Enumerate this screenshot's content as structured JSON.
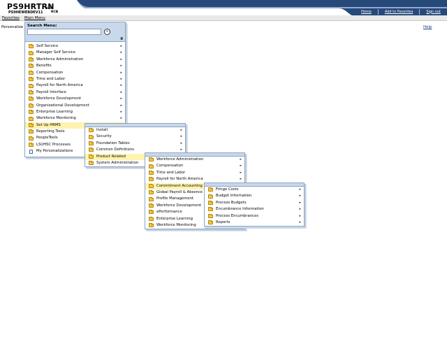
{
  "header": {
    "brand": "PS9HRTRN",
    "version": "9.00",
    "database": "PS9HEWEBDEV11",
    "user": "RCB",
    "links": [
      "Home",
      "Add to Favorites",
      "Sign out"
    ],
    "bar_color": "#27497a"
  },
  "menubar": {
    "items": [
      "Favorites",
      "Main Menu"
    ]
  },
  "page": {
    "personalize": "Personalize",
    "help": "Help"
  },
  "search_menu": {
    "title": "Search Menu:",
    "input_value": "",
    "go_label": "»",
    "scroll_top_label": "0"
  },
  "root_menu": {
    "items": [
      {
        "label": "Self Service",
        "icon": "folder-icon",
        "submenu": true
      },
      {
        "label": "Manager Self Service",
        "icon": "folder-icon",
        "submenu": true
      },
      {
        "label": "Workforce Administration",
        "icon": "folder-icon",
        "submenu": true
      },
      {
        "label": "Benefits",
        "icon": "folder-icon",
        "submenu": true
      },
      {
        "label": "Compensation",
        "icon": "folder-icon",
        "submenu": true
      },
      {
        "label": "Time and Labor",
        "icon": "folder-icon",
        "submenu": true
      },
      {
        "label": "Payroll for North America",
        "icon": "folder-icon",
        "submenu": true
      },
      {
        "label": "Payroll Interface",
        "icon": "folder-icon",
        "submenu": true
      },
      {
        "label": "Workforce Development",
        "icon": "folder-icon",
        "submenu": true
      },
      {
        "label": "Organizational Development",
        "icon": "folder-icon",
        "submenu": true
      },
      {
        "label": "Enterprise Learning",
        "icon": "folder-icon",
        "submenu": true
      },
      {
        "label": "Workforce Monitoring",
        "icon": "folder-icon",
        "submenu": true
      },
      {
        "label": "Set Up HRMS",
        "icon": "folder-icon",
        "submenu": true,
        "highlighted": true
      },
      {
        "label": "Reporting Tools",
        "icon": "folder-icon",
        "submenu": true
      },
      {
        "label": "PeopleTools",
        "icon": "folder-icon",
        "submenu": true
      },
      {
        "label": "LSUHSC Processes",
        "icon": "folder-icon",
        "submenu": true
      },
      {
        "label": "My Personalizations",
        "icon": "page-icon",
        "submenu": false
      }
    ]
  },
  "setup_menu": {
    "items": [
      {
        "label": "Install",
        "submenu": true
      },
      {
        "label": "Security",
        "submenu": true
      },
      {
        "label": "Foundation Tables",
        "submenu": true
      },
      {
        "label": "Common Definitions",
        "submenu": true
      },
      {
        "label": "Product Related",
        "submenu": true,
        "highlighted": true
      },
      {
        "label": "System Administration",
        "submenu": true
      }
    ]
  },
  "product_menu": {
    "items": [
      {
        "label": "Workforce Administration",
        "submenu": true
      },
      {
        "label": "Compensation",
        "submenu": true
      },
      {
        "label": "Time and Labor",
        "submenu": true
      },
      {
        "label": "Payroll for North America",
        "submenu": true
      },
      {
        "label": "Commitment Accounting",
        "submenu": true,
        "highlighted": true
      },
      {
        "label": "Global Payroll & Absence Mgmt",
        "submenu": true
      },
      {
        "label": "Profile Management",
        "submenu": true
      },
      {
        "label": "Workforce Development",
        "submenu": true
      },
      {
        "label": "ePerformance",
        "submenu": true
      },
      {
        "label": "Enterprise Learning",
        "submenu": true
      },
      {
        "label": "Workforce Monitoring",
        "submenu": true
      }
    ]
  },
  "commit_menu": {
    "items": [
      {
        "label": "Fringe Costs",
        "submenu": true
      },
      {
        "label": "Budget Information",
        "submenu": true
      },
      {
        "label": "Process Budgets",
        "submenu": true
      },
      {
        "label": "Encumbrance Information",
        "submenu": true
      },
      {
        "label": "Process Encumbrances",
        "submenu": true
      },
      {
        "label": "Reports",
        "submenu": true
      }
    ]
  },
  "colors": {
    "highlight": "#fff3b0",
    "menu_frame": "#c9d8ea",
    "folder": "#f5c73a"
  }
}
